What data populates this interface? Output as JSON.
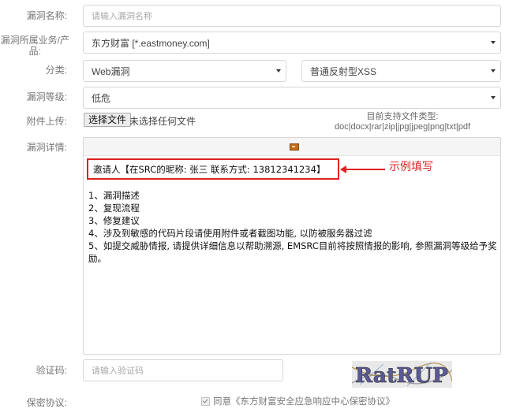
{
  "form": {
    "name_label": "漏洞名称:",
    "name_placeholder": "请输入漏洞名称",
    "asset_label_line1": "漏洞所属业务/产",
    "asset_label_line2": "品:",
    "asset_value": "东方财富 [*.eastmoney.com]",
    "category_label": "分类:",
    "category_value": "Web漏洞",
    "subcategory_value": "普通反射型XSS",
    "level_label": "漏洞等级:",
    "level_value": "低危",
    "attach_label": "附件上传:",
    "file_button": "选择文件",
    "file_none": "未选择任何文件",
    "file_types_line1": "目前支持文件类型:",
    "file_types_line2": "doc|docx|rar|zip|jpg|jpeg|png|txt|pdf",
    "detail_label": "漏洞详情:",
    "captcha_label": "验证码:",
    "captcha_placeholder": "请输入验证码",
    "captcha_text": "RatRUP",
    "agreement_label": "保密协议:",
    "agreement_text": "同意《东方财富安全应急响应中心保密协议》"
  },
  "editor": {
    "invite_line": "邀请人【在SRC的昵称: 张三 联系方式: 13812341234】",
    "annotation": "示例填写",
    "steps": [
      "1、漏洞描述",
      "2、复现流程",
      "3、修复建议",
      "4、涉及到敏感的代码片段请使用附件或者截图功能, 以防被服务器过滤",
      "5、如提交威胁情报, 请提供详细信息以帮助溯源, EMSRC目前将按照情报的影响, 参照漏洞等级给予奖励。"
    ]
  },
  "colors": {
    "annotation_red": "#dd2222",
    "border_gray": "#d6d6d6"
  }
}
